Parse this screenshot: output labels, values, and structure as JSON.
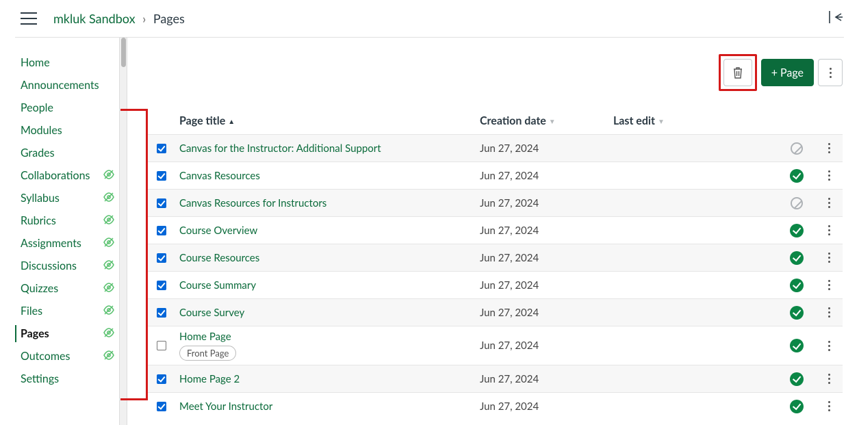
{
  "breadcrumb": {
    "course": "mkluk Sandbox",
    "page": "Pages"
  },
  "sidebar": {
    "items": [
      {
        "label": "Home",
        "hidden": false,
        "active": false
      },
      {
        "label": "Announcements",
        "hidden": false,
        "active": false
      },
      {
        "label": "People",
        "hidden": false,
        "active": false
      },
      {
        "label": "Modules",
        "hidden": false,
        "active": false
      },
      {
        "label": "Grades",
        "hidden": false,
        "active": false
      },
      {
        "label": "Collaborations",
        "hidden": true,
        "active": false
      },
      {
        "label": "Syllabus",
        "hidden": true,
        "active": false
      },
      {
        "label": "Rubrics",
        "hidden": true,
        "active": false
      },
      {
        "label": "Assignments",
        "hidden": true,
        "active": false
      },
      {
        "label": "Discussions",
        "hidden": true,
        "active": false
      },
      {
        "label": "Quizzes",
        "hidden": true,
        "active": false
      },
      {
        "label": "Files",
        "hidden": true,
        "active": false
      },
      {
        "label": "Pages",
        "hidden": true,
        "active": true
      },
      {
        "label": "Outcomes",
        "hidden": true,
        "active": false
      },
      {
        "label": "Settings",
        "hidden": false,
        "active": false
      }
    ]
  },
  "toolbar": {
    "add_page_label": "Page"
  },
  "table": {
    "headers": {
      "title": "Page title",
      "created": "Creation date",
      "edited": "Last edit"
    },
    "rows": [
      {
        "title": "Canvas for the Instructor: Additional Support",
        "created": "Jun 27, 2024",
        "checked": true,
        "published": false,
        "front": false
      },
      {
        "title": "Canvas Resources",
        "created": "Jun 27, 2024",
        "checked": true,
        "published": true,
        "front": false
      },
      {
        "title": "Canvas Resources for Instructors",
        "created": "Jun 27, 2024",
        "checked": true,
        "published": false,
        "front": false
      },
      {
        "title": "Course Overview",
        "created": "Jun 27, 2024",
        "checked": true,
        "published": true,
        "front": false
      },
      {
        "title": "Course Resources",
        "created": "Jun 27, 2024",
        "checked": true,
        "published": true,
        "front": false
      },
      {
        "title": "Course Summary",
        "created": "Jun 27, 2024",
        "checked": true,
        "published": true,
        "front": false
      },
      {
        "title": "Course Survey",
        "created": "Jun 27, 2024",
        "checked": true,
        "published": true,
        "front": false
      },
      {
        "title": "Home Page",
        "created": "Jun 27, 2024",
        "checked": false,
        "published": true,
        "front": true,
        "front_label": "Front Page"
      },
      {
        "title": "Home Page 2",
        "created": "Jun 27, 2024",
        "checked": true,
        "published": true,
        "front": false
      },
      {
        "title": "Meet Your Instructor",
        "created": "Jun 27, 2024",
        "checked": true,
        "published": true,
        "front": false
      }
    ]
  }
}
